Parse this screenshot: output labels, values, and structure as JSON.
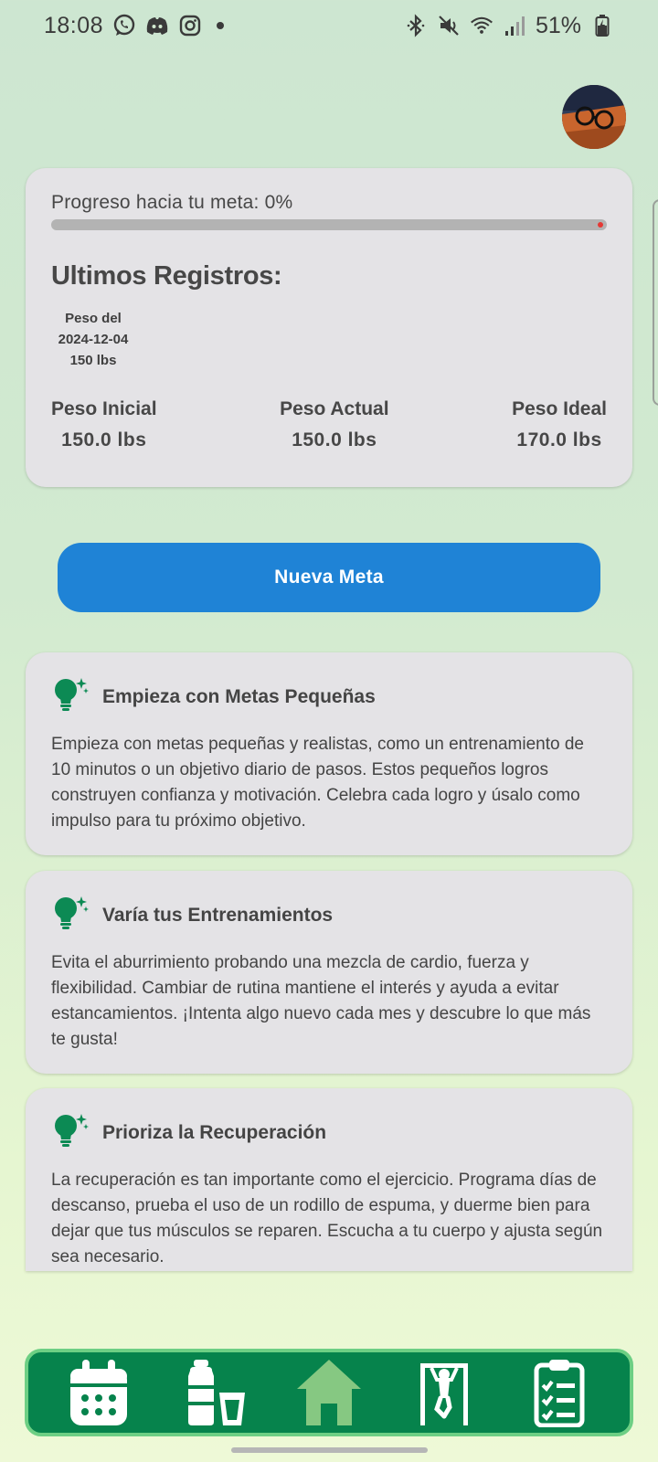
{
  "status_bar": {
    "time": "18:08",
    "battery_percent": "51%",
    "left_icons": [
      "whatsapp-icon",
      "discord-icon",
      "instagram-icon",
      "notification-dot-icon"
    ],
    "right_icons": [
      "bluetooth-icon",
      "vibrate-mute-icon",
      "wifi-icon",
      "signal-icon",
      "battery-icon"
    ]
  },
  "progress_card": {
    "progress_label": "Progreso hacia tu meta: 0%",
    "progress_value": 0,
    "records_title": "Ultimos Registros:",
    "record": {
      "line1": "Peso del",
      "line2": "2024-12-04",
      "line3": "150 lbs"
    },
    "stats": [
      {
        "label": "Peso Inicial",
        "value": "150.0 lbs"
      },
      {
        "label": "Peso Actual",
        "value": "150.0 lbs"
      },
      {
        "label": "Peso Ideal",
        "value": "170.0 lbs"
      }
    ]
  },
  "new_goal_button": {
    "label": "Nueva Meta"
  },
  "tips": [
    {
      "title": "Empieza con Metas Pequeñas",
      "body": "Empieza con metas pequeñas y realistas, como un entrenamiento de 10 minutos o un objetivo diario de pasos. Estos pequeños logros construyen confianza y motivación. Celebra cada logro y úsalo como impulso para tu próximo objetivo."
    },
    {
      "title": "Varía tus Entrenamientos",
      "body": "Evita el aburrimiento probando una mezcla de cardio, fuerza y flexibilidad. Cambiar de rutina mantiene el interés y ayuda a evitar estancamientos. ¡Intenta algo nuevo cada mes y descubre lo que más te gusta!"
    },
    {
      "title": "Prioriza la Recuperación",
      "body": "La recuperación es tan importante como el ejercicio. Programa días de descanso, prueba el uso de un rodillo de espuma, y duerme bien para dejar que tus músculos se reparen. Escucha a tu cuerpo y ajusta según sea necesario."
    }
  ],
  "bottom_nav": {
    "items": [
      {
        "icon": "calendar-icon",
        "active": false
      },
      {
        "icon": "water-bottle-icon",
        "active": false
      },
      {
        "icon": "home-icon",
        "active": true
      },
      {
        "icon": "exercise-icon",
        "active": false
      },
      {
        "icon": "clipboard-checklist-icon",
        "active": false
      }
    ]
  },
  "colors": {
    "accent_blue": "#1f83d6",
    "nav_green": "#06834c",
    "nav_active": "#86c882",
    "tip_icon_green": "#0c8a54",
    "card_bg": "#e4e3e6"
  }
}
